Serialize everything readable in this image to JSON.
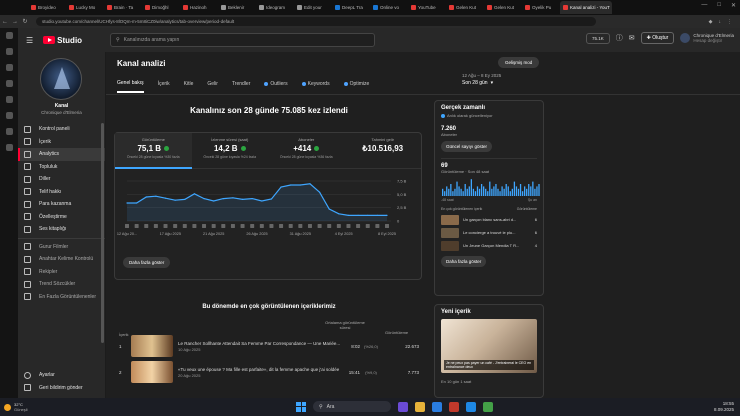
{
  "browser": {
    "tabs": [
      {
        "title": "Broyideo",
        "color": "#e53935"
      },
      {
        "title": "Lucky Mo",
        "color": "#e53935"
      },
      {
        "title": "Brain · Ta",
        "color": "#e53935"
      },
      {
        "title": "Dimoğhl",
        "color": "#e53935"
      },
      {
        "title": "Hazinoh",
        "color": "#e53935"
      },
      {
        "title": "Beklenir",
        "color": "#999999"
      },
      {
        "title": "Ideogram",
        "color": "#999999"
      },
      {
        "title": "Edit your",
        "color": "#999999"
      },
      {
        "title": "DeepL Tra",
        "color": "#1976d2"
      },
      {
        "title": "Online vo",
        "color": "#1976d2"
      },
      {
        "title": "YouTube",
        "color": "#e53935"
      },
      {
        "title": "Gelen Kut",
        "color": "#e53935"
      },
      {
        "title": "Gelen Kut",
        "color": "#e53935"
      },
      {
        "title": "Oyelik Pu",
        "color": "#e53935"
      },
      {
        "title": "Kanal analizi - YouT",
        "color": "#e53935"
      }
    ],
    "url": "studio.youtube.com/channel/UCHfys-8lOQm-m-5m8iCZ0iw/analytics/tab-overview/period-default"
  },
  "header": {
    "logo_text": "Studio",
    "search_placeholder": "Kanalınızda arama yapın",
    "pill_text": "75.1K",
    "create_label": "Oluştur",
    "account_name": "Chronique d'Elmeria",
    "account_sub": "Hesap değiştir"
  },
  "sidebar": {
    "channel_label": "Kanal",
    "channel_name": "Chronique d'Elmeria",
    "items": [
      {
        "label": "Kontrol paneli",
        "icon": "dashboard-icon"
      },
      {
        "label": "İçerik",
        "icon": "content-icon"
      },
      {
        "label": "Analytics",
        "icon": "analytics-icon"
      },
      {
        "label": "Topluluk",
        "icon": "community-icon"
      },
      {
        "label": "Diller",
        "icon": "languages-icon"
      },
      {
        "label": "Telif hakkı",
        "icon": "copyright-icon"
      },
      {
        "label": "Para kazanma",
        "icon": "monetization-icon"
      },
      {
        "label": "Özelleştirme",
        "icon": "customization-icon"
      },
      {
        "label": "Ses kitaplığı",
        "icon": "audio-library-icon"
      },
      {
        "label": "Gurur Filmler",
        "icon": "film-icon"
      },
      {
        "label": "Anahtar Kelime Kontrolü",
        "icon": "keyword-icon"
      },
      {
        "label": "Rekipler",
        "icon": "plugin-icon"
      },
      {
        "label": "Trend Sözcükler",
        "icon": "trend-icon"
      },
      {
        "label": "En Fazla Görüntülenenler",
        "icon": "views-icon"
      }
    ],
    "settings_label": "Ayarlar",
    "feedback_label": "Geri bildirim gönder"
  },
  "main": {
    "title": "Kanal analizi",
    "advanced_mode": "Gelişmiş mod",
    "tabs": [
      "Genel bakış",
      "İçerik",
      "Kitle",
      "Gelir",
      "Trendler",
      "Outliers",
      "Keywords",
      "Optimize"
    ],
    "date_range_label": "12 Ağu – 8 Ey 2025",
    "date_range_value": "Son 28 gün",
    "headline": "Kanalınız son 28 günde 75.085 kez izlendi",
    "metrics": [
      {
        "label": "Görüntüleme",
        "value": "75,1 B",
        "sub": "Önceki 28 güne kıyasla %30 fazla"
      },
      {
        "label": "İzlenme süresi (saat)",
        "value": "14,2 B",
        "sub": "Önceki 28 güne kıyasla %24 fazla"
      },
      {
        "label": "Aboneler",
        "value": "+414",
        "sub": "Önceki 28 güne kıyasla %36 fazla"
      },
      {
        "label": "Tahmini gelir",
        "value": "₺10.516,93",
        "sub": ""
      }
    ],
    "more_button": "Daha fazla göster",
    "top_content_title": "Bu dönemde en çok görüntülenen içeriklerimiz",
    "table_headers": {
      "content": "İçerik",
      "avg_duration": "Ortalama görüntüleme süresi",
      "views": "Görüntüleme"
    },
    "top_videos": [
      {
        "rank": "1",
        "title": "Le Rancher Sollhante Attendait Sa Femme Par Correspondance — Une Mariée...",
        "date": "10 Ağu 2025",
        "duration": "8:02",
        "pct": "(%26,0)",
        "views": "22.673"
      },
      {
        "rank": "2",
        "title": "«Tu veux une épouse ? Ma fille est parfaite», dit la femme apache que j'ai soldée",
        "date": "20 Ağu 2025",
        "duration": "15:41",
        "pct": "(%9,0)",
        "views": "7.773"
      }
    ]
  },
  "realtime": {
    "title": "Gerçek zamanlı",
    "live_label": "Anlık olarak güncelleniyor",
    "subs_value": "7.260",
    "subs_label": "Aboneler",
    "live_count_button": "Güncel sayıyı göster",
    "views_value": "69",
    "views_label": "Görüntüleme · Son 48 saat",
    "axis_left": "-48 saat",
    "axis_right": "Şu an",
    "top_label": "En çok görüntülenen içerik",
    "top_col": "Görüntüleme",
    "videos": [
      {
        "title": "Un garçon blanc sans-abri d...",
        "count": "6"
      },
      {
        "title": "Le concierge a trouvé le plu...",
        "count": "6"
      },
      {
        "title": "Un Jeune Garçon Mendia T R...",
        "count": "4"
      }
    ],
    "more_button": "Daha fazla göster"
  },
  "latest": {
    "title": "Yeni içerik",
    "thumb_caption": "Je ne peux pas payer un café - J'entrainerai le CEO en entraînance deux",
    "date": "En 10 gün 1 saat"
  },
  "taskbar": {
    "weather_temp": "32°C",
    "weather_desc": "Güneşli",
    "search_label": "Ara",
    "time": "18:55",
    "date": "8.09.2025"
  },
  "chart_data": {
    "type": "line",
    "series": [
      {
        "values": [
          0.45,
          0.45,
          0.6,
          0.62,
          0.57,
          0.52,
          0.54,
          0.68,
          0.56,
          0.5,
          0.56,
          0.58,
          0.54,
          0.56,
          0.5,
          0.55,
          0.85,
          0.9,
          0.9,
          0.93,
          0.72,
          0.3,
          0.18,
          0.14,
          0.14,
          0.14,
          0.14,
          0.14
        ]
      }
    ],
    "x_ticks": [
      "12 Ağu 20...",
      "17 Ağu 2025",
      "21 Ağu 2025",
      "26 Ağu 2025",
      "31 Ağu 2025",
      "4 Eyl 2025",
      "8 Eyl 2025"
    ],
    "y_ticks": [
      "7,5 B",
      "5,0 B",
      "2,5 B",
      "0"
    ],
    "ylim": [
      0,
      7.5
    ],
    "y_unit": "B"
  }
}
